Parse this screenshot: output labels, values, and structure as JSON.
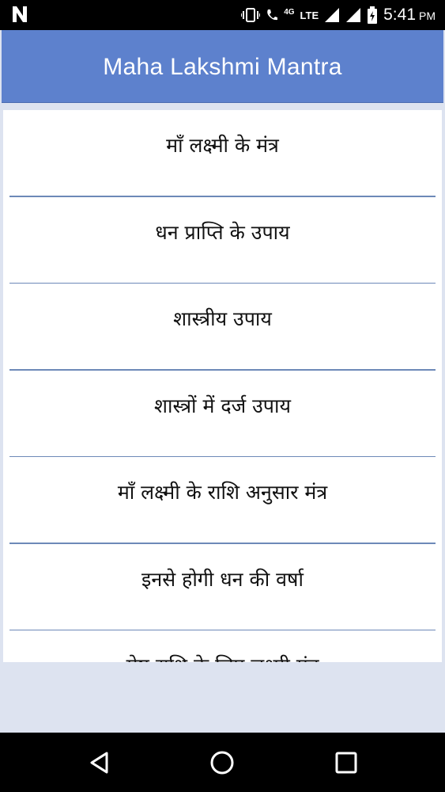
{
  "status_bar": {
    "network_small": "4G",
    "network": "LTE",
    "time": "5:41",
    "ampm": "PM"
  },
  "app_bar": {
    "title": "Maha Lakshmi Mantra"
  },
  "menu": {
    "items": [
      {
        "label": "माँ लक्ष्मी के मंत्र"
      },
      {
        "label": "धन प्राप्ति के उपाय"
      },
      {
        "label": "शास्त्रीय उपाय"
      },
      {
        "label": "शास्त्रों में दर्ज उपाय"
      },
      {
        "label": "माँ लक्ष्मी के राशि अनुसार मंत्र"
      },
      {
        "label": "इनसे होगी धन की वर्षा"
      },
      {
        "label": "मेष राशि के लिए लक्ष्मी मंत्र"
      }
    ]
  },
  "nav_bar": {
    "icons": [
      "back-icon",
      "home-icon",
      "recents-icon"
    ]
  }
}
